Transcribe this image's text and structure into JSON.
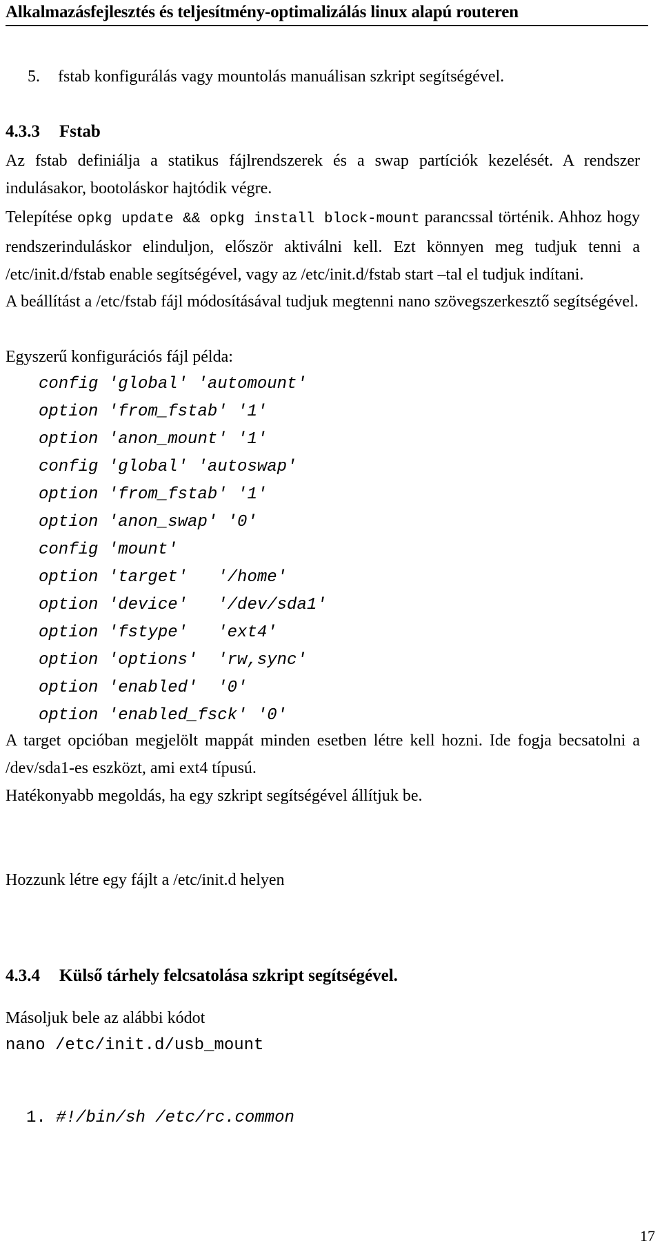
{
  "document": {
    "running_header": "Alkalmazásfejlesztés és teljesítmény-optimalizálás linux alapú routeren",
    "page_number": "17"
  },
  "list_item": {
    "number": "5.",
    "text": "fstab konfigurálás vagy mountolás manuálisan szkript segítségével."
  },
  "sections": {
    "s433": {
      "number": "4.3.3",
      "title": "Fstab"
    },
    "s434": {
      "number": "4.3.4",
      "title": "Külső tárhely felcsatolása szkript segítségével."
    }
  },
  "paragraphs": {
    "p1": "Az fstab definiálja a statikus fájlrendszerek és a swap partíciók kezelését. A rendszer indulásakor, bootoláskor hajtódik végre.",
    "p2_pre": "Telepítése ",
    "p2_code": "opkg update && opkg install block-mount",
    "p2_post": " parancssal történik. Ahhoz hogy rendszerinduláskor elinduljon, először aktiválni kell. Ezt könnyen meg tudjuk tenni a /etc/init.d/fstab enable segítségével, vagy az /etc/init.d/fstab start –tal el tudjuk indítani.",
    "p3": "A beállítást a /etc/fstab fájl módosításával tudjuk megtenni nano szövegszerkesztő segítségével.",
    "p4": "Egyszerű konfigurációs fájl példa:",
    "p5": "A target opcióban megjelölt mappát minden esetben létre kell hozni. Ide fogja becsatolni a /dev/sda1-es eszközt, ami ext4 típusú.",
    "p6": "Hatékonyabb megoldás, ha egy szkript segítségével állítjuk be.",
    "p7": "Hozzunk létre egy fájlt a /etc/init.d helyen",
    "p8": "Másoljuk bele az alábbi kódot"
  },
  "code": {
    "config_example": "config 'global' 'automount'\noption 'from_fstab' '1'\noption 'anon_mount' '1'\nconfig 'global' 'autoswap'\noption 'from_fstab' '1'\noption 'anon_swap' '0'\nconfig 'mount'\noption 'target'   '/home'\noption 'device'   '/dev/sda1'\noption 'fstype'   'ext4'\noption 'options'  'rw,sync'\noption 'enabled'  '0'\noption 'enabled_fsck' '0'",
    "nano_command": "nano /etc/init.d/usb_mount",
    "shebang_index": "1.",
    "shebang_text": "#!/bin/sh /etc/rc.common"
  }
}
